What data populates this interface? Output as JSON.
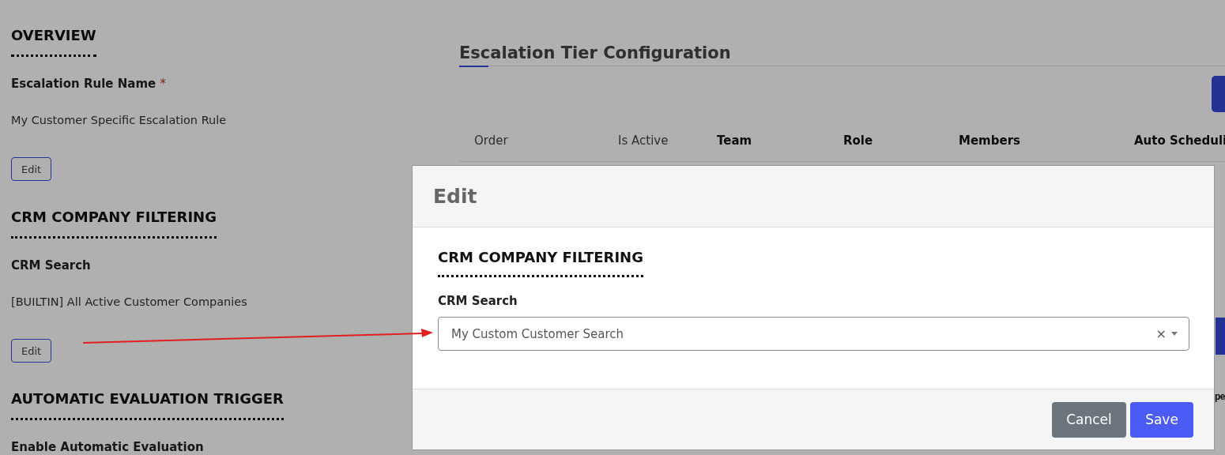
{
  "sections": [
    {
      "title": "OVERVIEW",
      "fields": [
        {
          "label": "Escalation Rule Name",
          "required_mark": "*",
          "value": "My Customer Specific Escalation Rule",
          "button": "Edit"
        }
      ]
    },
    {
      "title": "CRM COMPANY FILTERING",
      "fields": [
        {
          "label": "CRM Search",
          "value": "[BUILTIN] All Active Customer Companies",
          "button": "Edit"
        }
      ]
    },
    {
      "title": "AUTOMATIC EVALUATION TRIGGER",
      "fields": [
        {
          "label": "Enable Automatic Evaluation"
        }
      ]
    }
  ],
  "tier_panel": {
    "title": "Escalation Tier Configuration",
    "columns": [
      {
        "label": "Order",
        "kind": "muted"
      },
      {
        "label": "Is Active",
        "kind": "muted"
      },
      {
        "label": "Team",
        "kind": "strong"
      },
      {
        "label": "Role",
        "kind": "strong"
      },
      {
        "label": "Members",
        "kind": "strong"
      },
      {
        "label": "Auto Scheduli",
        "kind": "strong"
      }
    ],
    "cut_header": "pe"
  },
  "modal": {
    "title": "Edit",
    "section_title": "CRM COMPANY FILTERING",
    "field_label": "CRM Search",
    "field_value": "My Custom Customer Search",
    "clear_symbol": "×",
    "buttons": [
      {
        "label": "Cancel",
        "kind": "secondary"
      },
      {
        "label": "Save",
        "kind": "primary"
      }
    ]
  }
}
